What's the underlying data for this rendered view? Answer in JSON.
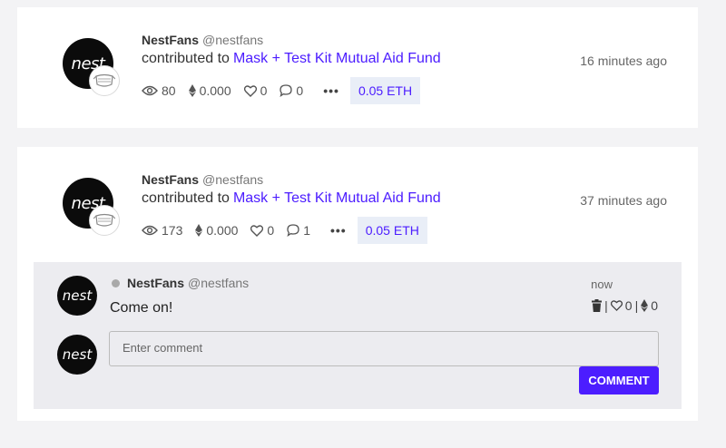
{
  "posts": [
    {
      "avatar_text": "nest",
      "name": "NestFans",
      "handle": "@nestfans",
      "action": "contributed to",
      "fund": "Mask + Test Kit Mutual Aid Fund",
      "time": "16 minutes ago",
      "views": "80",
      "eth_tips": "0.000",
      "likes": "0",
      "comments": "0",
      "more": "•••",
      "amount": "0.05 ETH"
    },
    {
      "avatar_text": "nest",
      "name": "NestFans",
      "handle": "@nestfans",
      "action": "contributed to",
      "fund": "Mask + Test Kit Mutual Aid Fund",
      "time": "37 minutes ago",
      "views": "173",
      "eth_tips": "0.000",
      "likes": "0",
      "comments": "1",
      "more": "•••",
      "amount": "0.05 ETH"
    }
  ],
  "comment": {
    "avatar_text": "nest",
    "name": "NestFans",
    "handle": "@nestfans",
    "text": "Come on!",
    "time": "now",
    "likes": "0",
    "eth": "0",
    "separator": "|"
  },
  "composer": {
    "avatar_text": "nest",
    "placeholder": "Enter comment",
    "button_label": "COMMENT"
  },
  "colors": {
    "accent": "#4c1dff",
    "badge_bg": "#e9eef7",
    "panel_bg": "#ececf0"
  }
}
